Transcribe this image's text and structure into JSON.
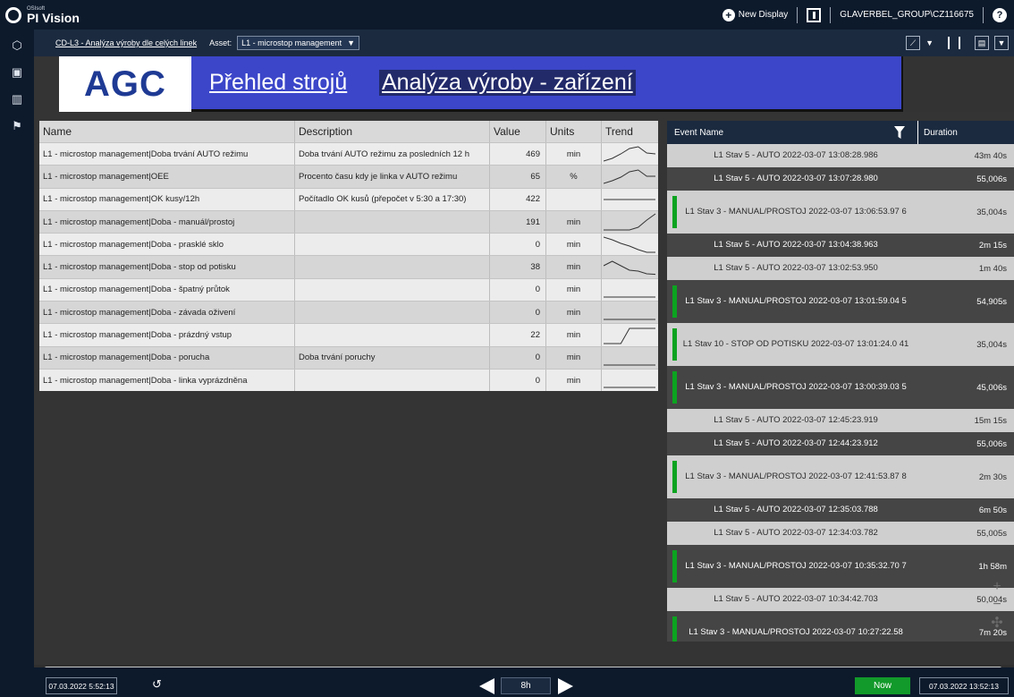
{
  "app": {
    "brand_small": "OSIsoft",
    "brand_main": "PI Vision",
    "new_display": "New Display",
    "user": "GLAVERBEL_GROUP\\CZ116675",
    "help": "?"
  },
  "subbar": {
    "breadcrumb": "CD-L3 - Analýza výroby dle celých linek",
    "asset_label": "Asset:",
    "asset_value": "L1 - microstop management"
  },
  "banner": {
    "logo": "AGC",
    "link1": "Přehled strojů",
    "link2": "Analýza výroby - zařízení"
  },
  "table": {
    "headers": [
      "Name",
      "Description",
      "Value",
      "Units",
      "Trend"
    ],
    "rows": [
      {
        "name": "L1 - microstop management|Doba trvání AUTO režimu",
        "desc": "Doba trvání AUTO režimu za posledních 12 h",
        "value": "469",
        "unit": "min",
        "trend": [
          0.1,
          0.25,
          0.5,
          0.8,
          0.9,
          0.55,
          0.5
        ]
      },
      {
        "name": "L1 - microstop management|OEE",
        "desc": "Procento času kdy je linka v AUTO režimu",
        "value": "65",
        "unit": "%",
        "trend": [
          0.1,
          0.25,
          0.45,
          0.75,
          0.85,
          0.5,
          0.5
        ]
      },
      {
        "name": "L1 - microstop management|OK kusy/12h",
        "desc": "Počítadlo OK kusů (přepočet v 5:30 a 17:30)",
        "value": "422",
        "unit": "",
        "trend": [
          0.5,
          0.5,
          0.5,
          0.5,
          0.5,
          0.5,
          0.5
        ]
      },
      {
        "name": "L1 - microstop management|Doba - manuál/prostoj",
        "desc": "",
        "value": "191",
        "unit": "min",
        "trend": [
          0.05,
          0.05,
          0.05,
          0.05,
          0.2,
          0.6,
          0.95
        ]
      },
      {
        "name": "L1 - microstop management|Doba - prasklé sklo",
        "desc": "",
        "value": "0",
        "unit": "min",
        "trend": [
          0.9,
          0.75,
          0.55,
          0.4,
          0.2,
          0.05,
          0.05
        ]
      },
      {
        "name": "L1 - microstop management|Doba - stop od potisku",
        "desc": "",
        "value": "38",
        "unit": "min",
        "trend": [
          0.6,
          0.85,
          0.6,
          0.35,
          0.3,
          0.15,
          0.12
        ]
      },
      {
        "name": "L1 - microstop management|Doba - špatný průtok",
        "desc": "",
        "value": "0",
        "unit": "min",
        "trend": [
          0.1,
          0.1,
          0.1,
          0.1,
          0.1,
          0.1,
          0.1
        ]
      },
      {
        "name": "L1 - microstop management|Doba - závada oživení",
        "desc": "",
        "value": "0",
        "unit": "min",
        "trend": [
          0.1,
          0.1,
          0.1,
          0.1,
          0.1,
          0.1,
          0.1
        ]
      },
      {
        "name": "L1 - microstop management|Doba - prázdný vstup",
        "desc": "",
        "value": "22",
        "unit": "min",
        "trend": [
          0.05,
          0.05,
          0.05,
          0.9,
          0.9,
          0.9,
          0.9
        ]
      },
      {
        "name": "L1 - microstop management|Doba - porucha",
        "desc": "Doba trvání poruchy",
        "value": "0",
        "unit": "min",
        "trend": [
          0.1,
          0.1,
          0.1,
          0.1,
          0.1,
          0.1,
          0.1
        ]
      },
      {
        "name": "L1 - microstop management|Doba - linka vyprázdněna",
        "desc": "",
        "value": "0",
        "unit": "min",
        "trend": [
          0.1,
          0.1,
          0.1,
          0.1,
          0.1,
          0.1,
          0.1
        ]
      }
    ]
  },
  "events": {
    "headers": [
      "Event Name",
      "Duration"
    ],
    "rows": [
      {
        "name": "L1 Stav 5 - AUTO 2022-03-07 13:08:28.986",
        "duration": "43m 40s",
        "shade": "lt",
        "mark": false,
        "tall": false
      },
      {
        "name": "L1 Stav 5 - AUTO 2022-03-07 13:07:28.980",
        "duration": "55,006s",
        "shade": "dk",
        "mark": false,
        "tall": false
      },
      {
        "name": "L1 Stav 3 - MANUAL/PROSTOJ 2022-03-07 13:06:53.97 6",
        "duration": "35,004s",
        "shade": "lt",
        "mark": true,
        "tall": true
      },
      {
        "name": "L1 Stav 5 - AUTO 2022-03-07 13:04:38.963",
        "duration": "2m 15s",
        "shade": "dk",
        "mark": false,
        "tall": false
      },
      {
        "name": "L1 Stav 5 - AUTO 2022-03-07 13:02:53.950",
        "duration": "1m 40s",
        "shade": "lt",
        "mark": false,
        "tall": false
      },
      {
        "name": "L1 Stav 3 - MANUAL/PROSTOJ 2022-03-07 13:01:59.04 5",
        "duration": "54,905s",
        "shade": "dk",
        "mark": true,
        "tall": true
      },
      {
        "name": "L1 Stav 10 - STOP OD POTISKU 2022-03-07 13:01:24.0 41",
        "duration": "35,004s",
        "shade": "lt",
        "mark": true,
        "tall": true
      },
      {
        "name": "L1 Stav 3 - MANUAL/PROSTOJ 2022-03-07 13:00:39.03 5",
        "duration": "45,006s",
        "shade": "dk",
        "mark": true,
        "tall": true
      },
      {
        "name": "L1 Stav 5 - AUTO 2022-03-07 12:45:23.919",
        "duration": "15m 15s",
        "shade": "lt",
        "mark": false,
        "tall": false
      },
      {
        "name": "L1 Stav 5 - AUTO 2022-03-07 12:44:23.912",
        "duration": "55,006s",
        "shade": "dk",
        "mark": false,
        "tall": false
      },
      {
        "name": "L1 Stav 3 - MANUAL/PROSTOJ 2022-03-07 12:41:53.87 8",
        "duration": "2m 30s",
        "shade": "lt",
        "mark": true,
        "tall": true
      },
      {
        "name": "L1 Stav 5 - AUTO 2022-03-07 12:35:03.788",
        "duration": "6m 50s",
        "shade": "dk",
        "mark": false,
        "tall": false
      },
      {
        "name": "L1 Stav 5 - AUTO 2022-03-07 12:34:03.782",
        "duration": "55,005s",
        "shade": "lt",
        "mark": false,
        "tall": false
      },
      {
        "name": "L1 Stav 3 - MANUAL/PROSTOJ 2022-03-07 10:35:32.70 7",
        "duration": "1h 58m",
        "shade": "dk",
        "mark": true,
        "tall": true
      },
      {
        "name": "L1 Stav 5 - AUTO 2022-03-07 10:34:42.703",
        "duration": "50,004s",
        "shade": "lt",
        "mark": false,
        "tall": false
      },
      {
        "name": "L1 Stav 3 - MANUAL/PROSTOJ 2022-03-07 10:27:22.58",
        "duration": "7m 20s",
        "shade": "dk",
        "mark": true,
        "tall": true
      }
    ]
  },
  "footer": {
    "start_time": "07.03.2022 5:52:13",
    "duration": "8h",
    "now_label": "Now",
    "end_time": "07.03.2022 13:52:13"
  },
  "colors": {
    "banner_bg": "#3b46c9",
    "nav_bg": "#0d1a2c",
    "event_marker": "#0ca320",
    "now_button": "#129a2a"
  }
}
